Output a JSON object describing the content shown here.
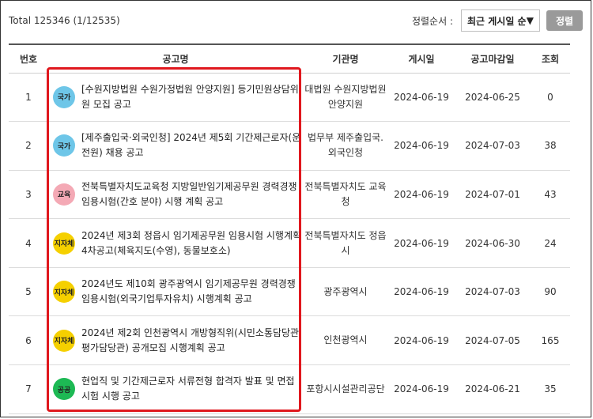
{
  "header": {
    "total_text": "Total 125346 (1/12535)",
    "sort_label": "정렬순서 :",
    "sort_value": "최근 게시일 순",
    "sort_button": "정렬"
  },
  "table": {
    "columns": [
      "번호",
      "공고명",
      "기관명",
      "게시일",
      "공고마감일",
      "조회"
    ],
    "rows": [
      {
        "no": "1",
        "badge": "국가",
        "badge_color": "#6ec6e8",
        "title": "[수원지방법원 수원가정법원 안양지원] 등기민원상담위원 모집 공고",
        "agency": "대법원 수원지방법원 안양지원",
        "posted": "2024-06-19",
        "deadline": "2024-06-25",
        "views": "0"
      },
      {
        "no": "2",
        "badge": "국가",
        "badge_color": "#6ec6e8",
        "title": "[제주출입국·외국인청] 2024년 제5회 기간제근로자(운전원) 채용 공고",
        "agency": "법무부 제주출입국.외국인청",
        "posted": "2024-06-19",
        "deadline": "2024-07-03",
        "views": "38"
      },
      {
        "no": "3",
        "badge": "교육",
        "badge_color": "#f4a9b5",
        "title": "전북특별자치도교육청 지방일반임기제공무원 경력경쟁임용시험(간호 분야) 시행 계획 공고",
        "agency": "전북특별자치도 교육청",
        "posted": "2024-06-19",
        "deadline": "2024-07-01",
        "views": "43"
      },
      {
        "no": "4",
        "badge": "지자체",
        "badge_color": "#f5d000",
        "title": "2024년 제3회 정읍시 임기제공무원 임용시험 시행계획 4차공고(체육지도(수영), 동물보호소)",
        "agency": "전북특별자치도 정읍시",
        "posted": "2024-06-19",
        "deadline": "2024-06-30",
        "views": "24"
      },
      {
        "no": "5",
        "badge": "지자체",
        "badge_color": "#f5d000",
        "title": "2024년도 제10회 광주광역시 임기제공무원 경력경쟁임용시험(외국기업투자유치) 시행계획 공고",
        "agency": "광주광역시",
        "posted": "2024-06-19",
        "deadline": "2024-07-03",
        "views": "90"
      },
      {
        "no": "6",
        "badge": "지자체",
        "badge_color": "#f5d000",
        "title": "2024년 제2회 인천광역시 개방형직위(시민소통담당관, 평가담당관) 공개모집 시행계획 공고",
        "agency": "인천광역시",
        "posted": "2024-06-19",
        "deadline": "2024-07-05",
        "views": "165"
      },
      {
        "no": "7",
        "badge": "공공",
        "badge_color": "#1db954",
        "title": "현업직 및 기간제근로자 서류전형 합격자 발표 및 면접시험 시행 공고",
        "agency": "포항시시설관리공단",
        "posted": "2024-06-19",
        "deadline": "2024-06-21",
        "views": "35"
      }
    ]
  },
  "highlight_color": "#e0181e"
}
